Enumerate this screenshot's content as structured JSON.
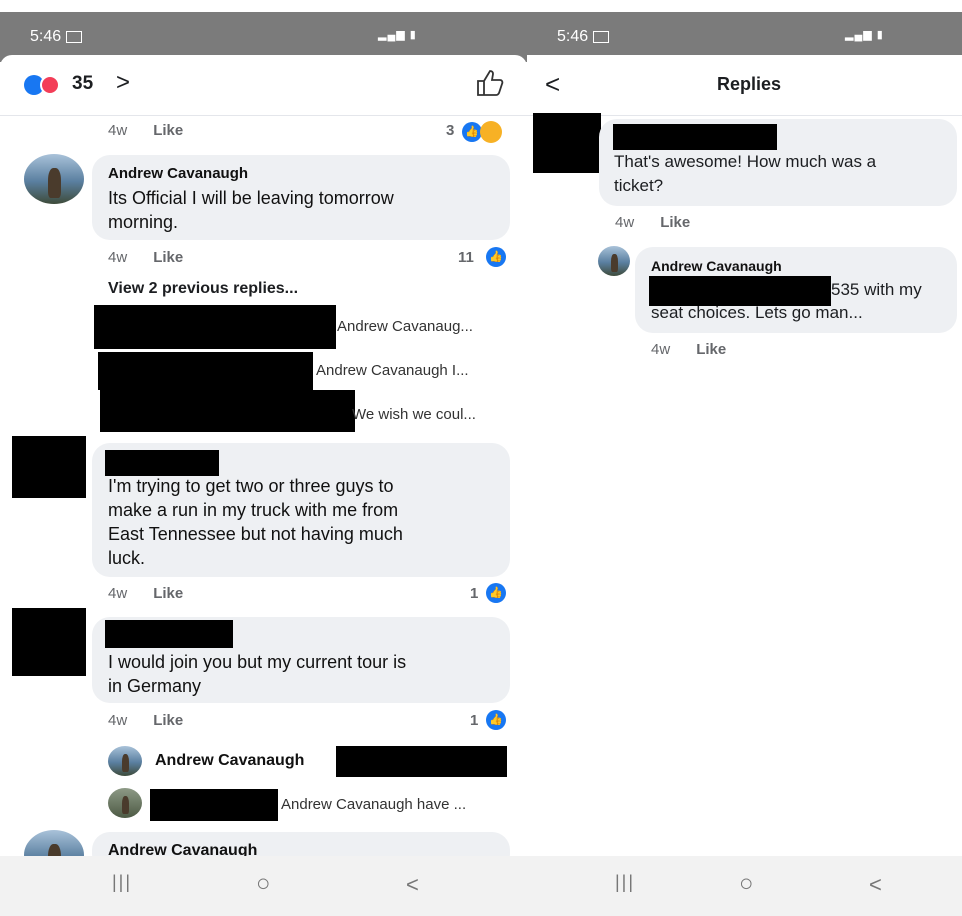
{
  "left": {
    "status": {
      "time": "5:46"
    },
    "header": {
      "reaction_count": "35",
      "chevron": ">",
      "like_icon": "thumbs-up-outline-icon"
    },
    "top_meta": {
      "time": "4w",
      "like": "Like",
      "count": "3"
    },
    "comment1": {
      "author": "Andrew Cavanaugh",
      "text_line1": "Its Official I will be leaving tomorrow",
      "text_line2": "morning.",
      "time": "4w",
      "like": "Like",
      "count": "11",
      "view_previous": "View 2 previous replies...",
      "replies": [
        {
          "text": "Andrew Cavanaug..."
        },
        {
          "text": "Andrew Cavanaugh I..."
        },
        {
          "text": "We wish we coul..."
        }
      ]
    },
    "comment2": {
      "text_lines": [
        "I'm trying to get two or three guys to",
        "make a run in my truck with me from",
        "East Tennessee but not having much",
        "luck."
      ],
      "time": "4w",
      "like": "Like",
      "count": "1"
    },
    "comment3": {
      "text_lines": [
        "I would join you but my current tour is",
        "in Germany"
      ],
      "time": "4w",
      "like": "Like",
      "count": "1",
      "reply1_author": "Andrew Cavanaugh",
      "reply2_text": "Andrew Cavanaugh have ..."
    },
    "comment4": {
      "author": "Andrew Cavanaugh"
    },
    "navbar": {
      "recent": "|||",
      "home": "○",
      "back": "<"
    }
  },
  "right": {
    "status": {
      "time": "5:46"
    },
    "header": {
      "back": "<",
      "title": "Replies"
    },
    "reply1": {
      "text_line1": "That's awesome! How much was a",
      "text_line2": "ticket?",
      "time": "4w",
      "like": "Like"
    },
    "reply2": {
      "author": "Andrew Cavanaugh",
      "text_line1_tail": "535 with my",
      "text_line2": "seat choices. Lets go man...",
      "time": "4w",
      "like": "Like"
    },
    "navbar": {
      "recent": "|||",
      "home": "○",
      "back": "<"
    }
  },
  "colors": {
    "accent": "#1877f2",
    "love": "#f33e58",
    "bubble": "#eef0f3",
    "statusbar": "#7b7b7b"
  }
}
